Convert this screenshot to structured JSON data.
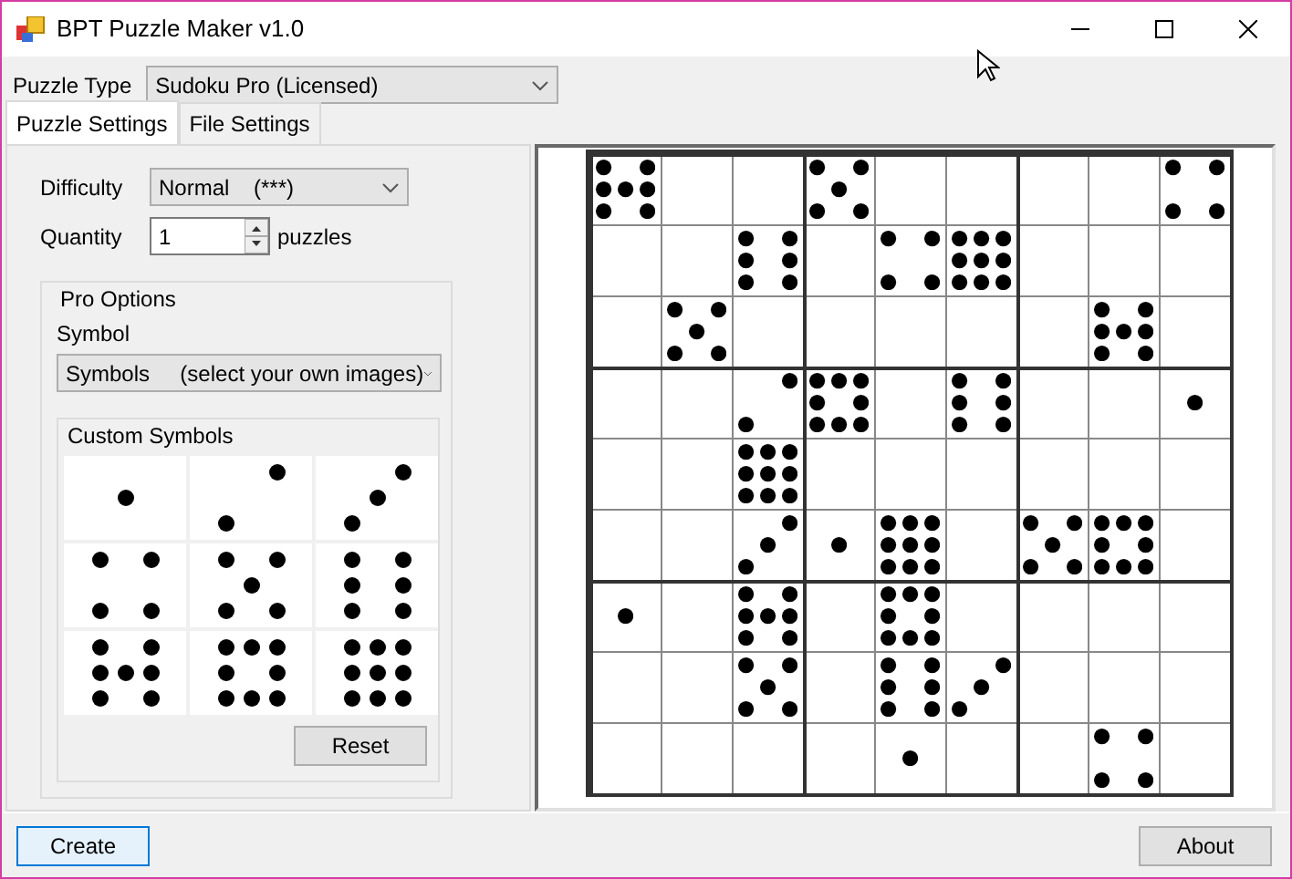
{
  "window": {
    "title": "BPT Puzzle Maker v1.0"
  },
  "puzzle_type": {
    "label": "Puzzle Type",
    "value": "Sudoku Pro (Licensed)"
  },
  "tabs": [
    {
      "label": "Puzzle Settings",
      "selected": true
    },
    {
      "label": "File Settings",
      "selected": false
    }
  ],
  "difficulty": {
    "label": "Difficulty",
    "value": "Normal    (***)"
  },
  "quantity": {
    "label": "Quantity",
    "value": "1",
    "unit": "puzzles"
  },
  "pro_options": {
    "title": "Pro Options",
    "symbol_label": "Symbol",
    "symbol_value": "Symbols     (select your own images)",
    "custom_symbols": {
      "title": "Custom Symbols",
      "symbols": [
        {
          "kind": "one"
        },
        {
          "kind": "two"
        },
        {
          "kind": "three"
        },
        {
          "kind": "four"
        },
        {
          "kind": "five"
        },
        {
          "kind": "six"
        },
        {
          "kind": "seven"
        },
        {
          "kind": "eight"
        },
        {
          "kind": "nine"
        }
      ],
      "reset": "Reset"
    }
  },
  "grid": [
    [
      {
        "kind": "seven"
      },
      {
        "kind": "empty"
      },
      {
        "kind": "empty"
      },
      {
        "kind": "five"
      },
      {
        "kind": "empty"
      },
      {
        "kind": "empty"
      },
      {
        "kind": "empty"
      },
      {
        "kind": "empty"
      },
      {
        "kind": "four"
      }
    ],
    [
      {
        "kind": "empty"
      },
      {
        "kind": "empty"
      },
      {
        "kind": "six"
      },
      {
        "kind": "empty"
      },
      {
        "kind": "four"
      },
      {
        "kind": "nine"
      },
      {
        "kind": "empty"
      },
      {
        "kind": "empty"
      },
      {
        "kind": "empty"
      }
    ],
    [
      {
        "kind": "empty"
      },
      {
        "kind": "five"
      },
      {
        "kind": "empty"
      },
      {
        "kind": "empty"
      },
      {
        "kind": "empty"
      },
      {
        "kind": "empty"
      },
      {
        "kind": "empty"
      },
      {
        "kind": "seven"
      },
      {
        "kind": "empty"
      }
    ],
    [
      {
        "kind": "empty"
      },
      {
        "kind": "empty"
      },
      {
        "kind": "two"
      },
      {
        "kind": "eight"
      },
      {
        "kind": "empty"
      },
      {
        "kind": "six"
      },
      {
        "kind": "empty"
      },
      {
        "kind": "empty"
      },
      {
        "kind": "one"
      }
    ],
    [
      {
        "kind": "empty"
      },
      {
        "kind": "empty"
      },
      {
        "kind": "nine"
      },
      {
        "kind": "empty"
      },
      {
        "kind": "empty"
      },
      {
        "kind": "empty"
      },
      {
        "kind": "empty"
      },
      {
        "kind": "empty"
      },
      {
        "kind": "empty"
      }
    ],
    [
      {
        "kind": "empty"
      },
      {
        "kind": "empty"
      },
      {
        "kind": "three"
      },
      {
        "kind": "one"
      },
      {
        "kind": "nine"
      },
      {
        "kind": "empty"
      },
      {
        "kind": "five"
      },
      {
        "kind": "eight"
      },
      {
        "kind": "empty"
      }
    ],
    [
      {
        "kind": "one"
      },
      {
        "kind": "empty"
      },
      {
        "kind": "seven"
      },
      {
        "kind": "empty"
      },
      {
        "kind": "eight"
      },
      {
        "kind": "empty"
      },
      {
        "kind": "empty"
      },
      {
        "kind": "empty"
      },
      {
        "kind": "empty"
      }
    ],
    [
      {
        "kind": "empty"
      },
      {
        "kind": "empty"
      },
      {
        "kind": "five"
      },
      {
        "kind": "empty"
      },
      {
        "kind": "six"
      },
      {
        "kind": "three"
      },
      {
        "kind": "empty"
      },
      {
        "kind": "empty"
      },
      {
        "kind": "empty"
      }
    ],
    [
      {
        "kind": "empty"
      },
      {
        "kind": "empty"
      },
      {
        "kind": "empty"
      },
      {
        "kind": "empty"
      },
      {
        "kind": "one"
      },
      {
        "kind": "empty"
      },
      {
        "kind": "empty"
      },
      {
        "kind": "four"
      },
      {
        "kind": "empty"
      }
    ]
  ],
  "buttons": {
    "create": "Create",
    "about": "About"
  }
}
